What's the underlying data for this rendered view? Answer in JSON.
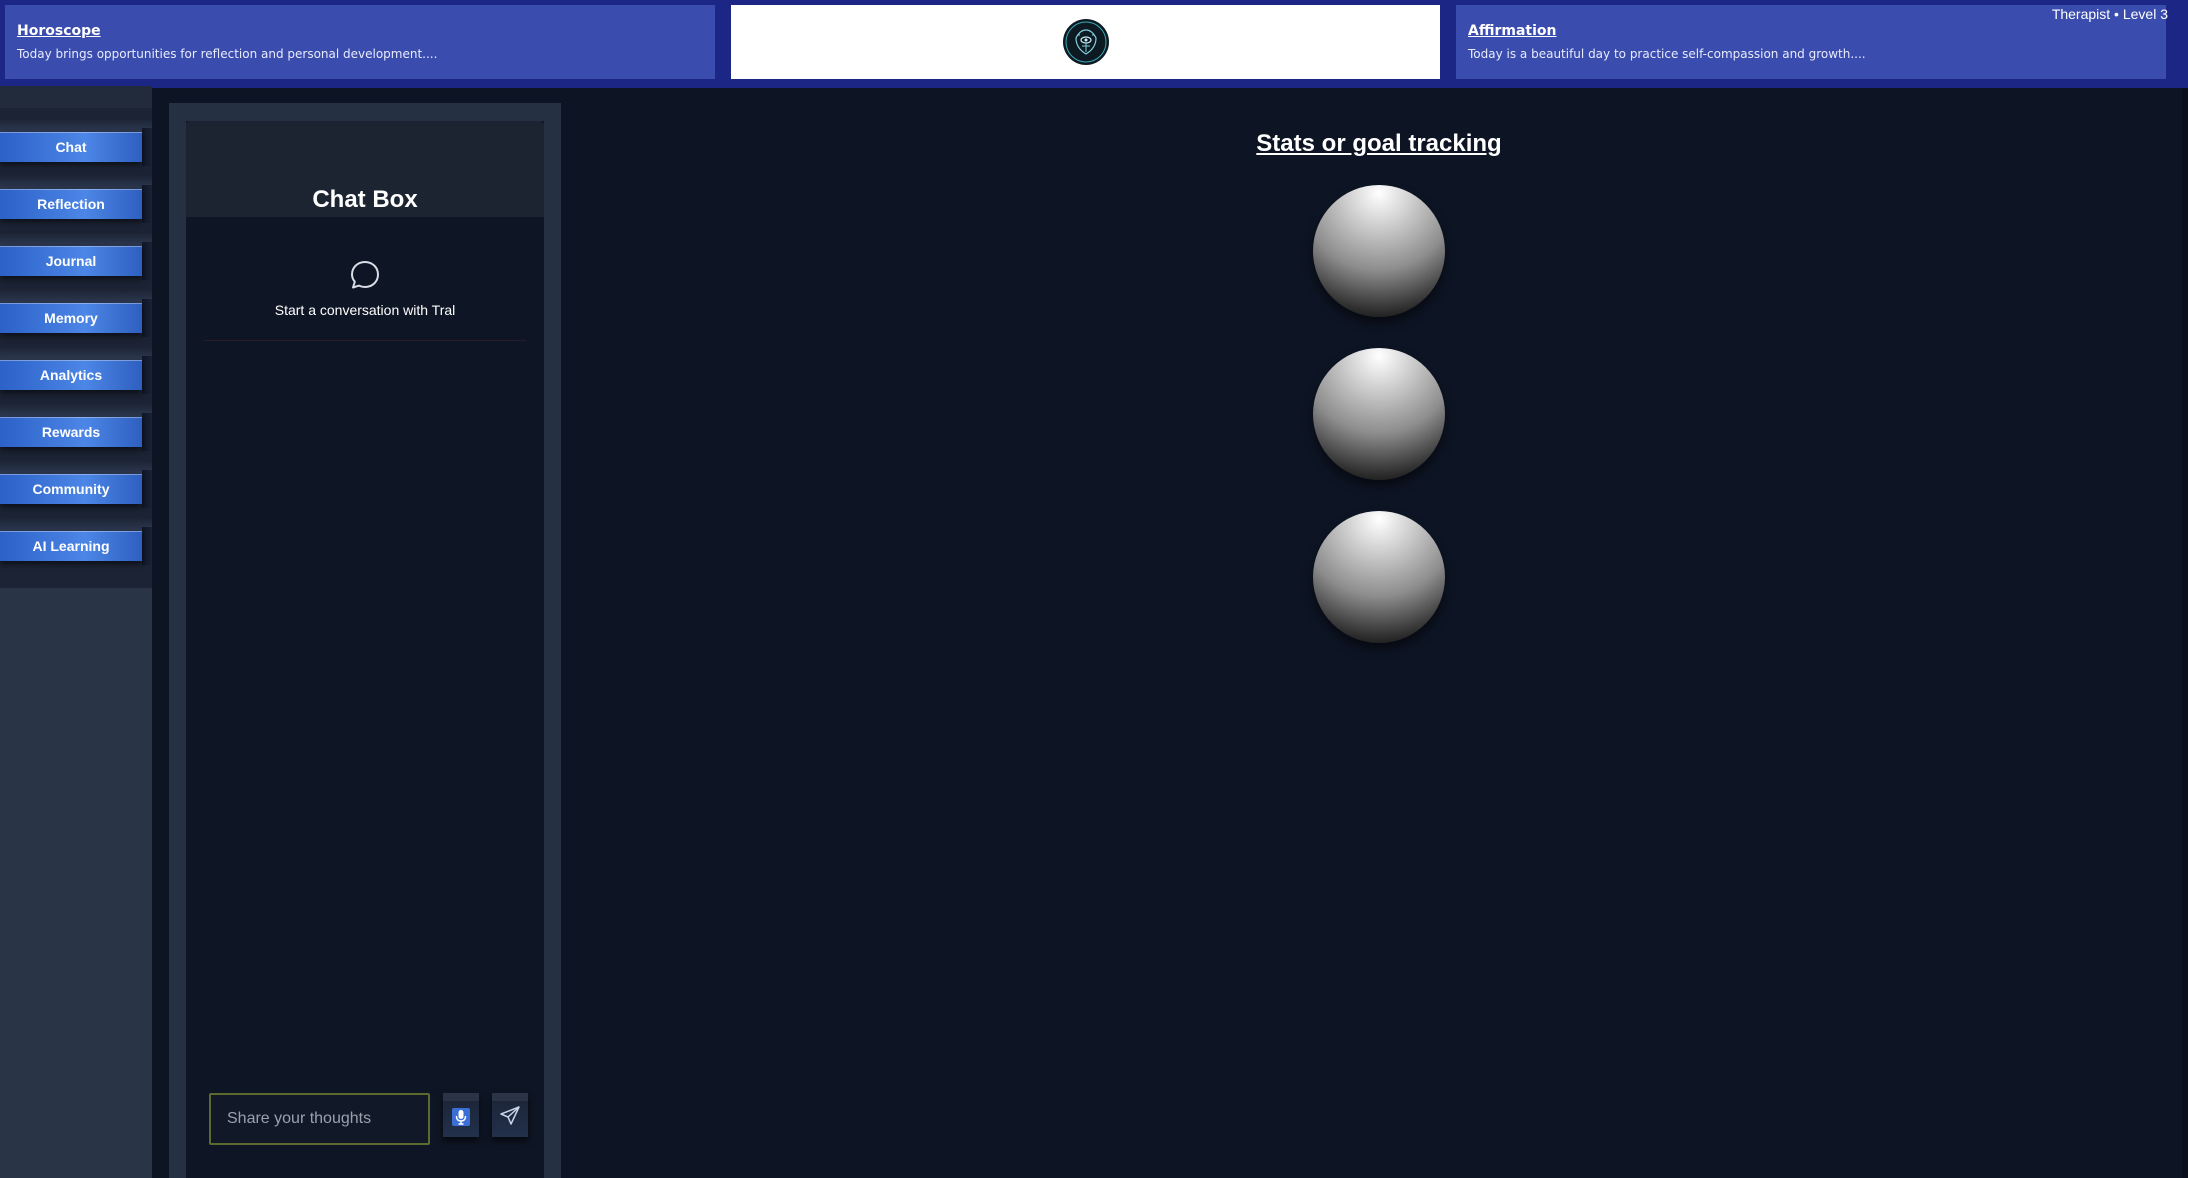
{
  "header": {
    "horoscope": {
      "title": "Horoscope",
      "text": "Today brings opportunities for reflection and personal development...."
    },
    "logo_icon": "brain-circuit-icon",
    "affirmation": {
      "title": "Affirmation",
      "text": "Today is a beautiful day to practice self-compassion and growth...."
    },
    "user_status": "Therapist • Level 3"
  },
  "sidebar": {
    "items": [
      {
        "label": "Chat"
      },
      {
        "label": "Reflection"
      },
      {
        "label": "Journal"
      },
      {
        "label": "Memory"
      },
      {
        "label": "Analytics"
      },
      {
        "label": "Rewards"
      },
      {
        "label": "Community"
      },
      {
        "label": "AI Learning"
      }
    ]
  },
  "chat": {
    "title": "Chat Box",
    "empty_icon": "chat-bubble-icon",
    "empty_message": "Start a conversation with Tral",
    "input_placeholder": "Share your thoughts",
    "mic_icon": "microphone-icon",
    "send_icon": "send-icon"
  },
  "stats": {
    "title": "Stats or goal tracking",
    "spheres": 3
  },
  "colors": {
    "background": "#0d1423",
    "topbar": "#1c2785",
    "card": "#3a4cad",
    "nav_button": "#4c86e6",
    "sidebar": "#2a3447",
    "input_border": "#5d6a2e"
  }
}
